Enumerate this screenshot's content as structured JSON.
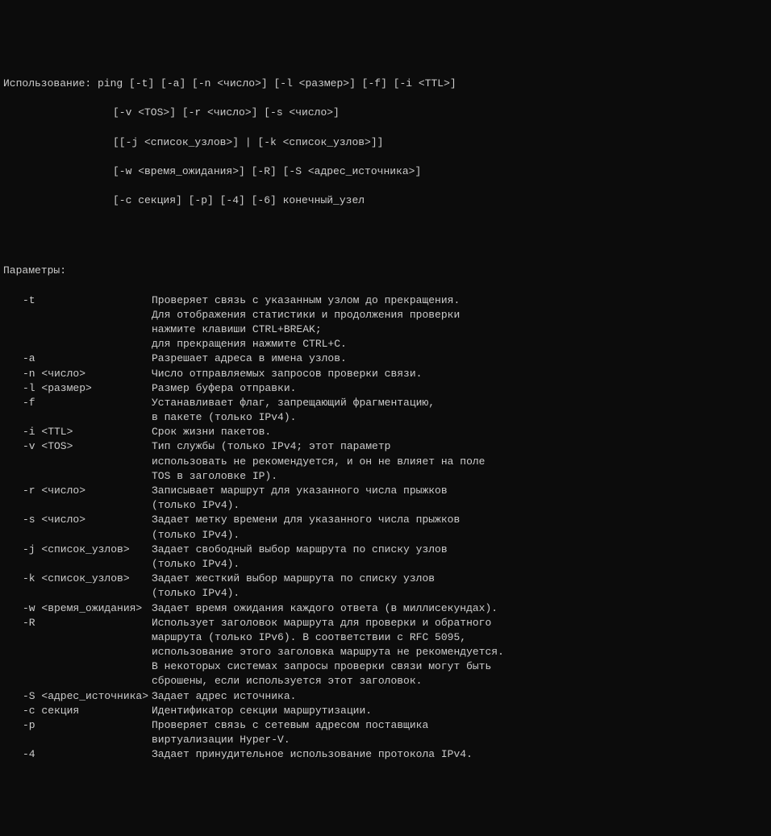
{
  "usage": {
    "label": "Использование:",
    "lines": [
      "ping [-t] [-a] [-n <число>] [-l <размер>] [-f] [-i <TTL>]",
      "[-v <TOS>] [-r <число>] [-s <число>]",
      "[[-j <список_узлов>] | [-k <список_узлов>]]",
      "[-w <время_ожидания>] [-R] [-S <адрес_источника>]",
      "[-c секция] [-p] [-4] [-6] конечный_узел"
    ]
  },
  "params_header": "Параметры:",
  "params": [
    {
      "opt": "-t",
      "desc": [
        "Проверяет связь с указанным узлом до прекращения.",
        "Для отображения статистики и продолжения проверки",
        "нажмите клавиши CTRL+BREAK;",
        "для прекращения нажмите CTRL+C."
      ]
    },
    {
      "opt": "-a",
      "desc": [
        "Разрешает адреса в имена узлов."
      ]
    },
    {
      "opt": "-n <число>",
      "desc": [
        "Число отправляемых запросов проверки связи."
      ]
    },
    {
      "opt": "-l <размер>",
      "desc": [
        "Размер буфера отправки."
      ]
    },
    {
      "opt": "-f",
      "desc": [
        "Устанавливает флаг, запрещающий фрагментацию,",
        "в пакете (только IPv4)."
      ]
    },
    {
      "opt": "-i <TTL>",
      "desc": [
        "Срок жизни пакетов."
      ]
    },
    {
      "opt": "-v <TOS>",
      "desc": [
        "Тип службы (только IPv4; этот параметр",
        "использовать не рекомендуется, и он не влияет на поле",
        "TOS в заголовке IP)."
      ]
    },
    {
      "opt": "-r <число>",
      "desc": [
        "Записывает маршрут для указанного числа прыжков",
        "(только IPv4)."
      ]
    },
    {
      "opt": "-s <число>",
      "desc": [
        "Задает метку времени для указанного числа прыжков",
        "(только IPv4)."
      ]
    },
    {
      "opt": "-j <список_узлов>",
      "desc": [
        "Задает свободный выбор маршрута по списку узлов",
        "(только IPv4)."
      ]
    },
    {
      "opt": "-k <список_узлов>",
      "desc": [
        "Задает жесткий выбор маршрута по списку узлов",
        "(только IPv4)."
      ]
    },
    {
      "opt": "-w <время_ожидания>",
      "desc": [
        "Задает время ожидания каждого ответа (в миллисекундах)."
      ]
    },
    {
      "opt": "-R",
      "desc": [
        "Использует заголовок маршрута для проверки и обратного",
        "маршрута (только IPv6). В соответствии с RFC 5095,",
        "использование этого заголовка маршрута не рекомендуется.",
        "В некоторых системах запросы проверки связи могут быть",
        "сброшены, если используется этот заголовок."
      ]
    },
    {
      "opt": "-S <адрес_источника>",
      "desc": [
        "Задает адрес источника."
      ]
    },
    {
      "opt": "-c секция",
      "desc": [
        "Идентификатор секции маршрутизации."
      ]
    },
    {
      "opt": "-p",
      "desc": [
        "Проверяет связь с сетевым адресом поставщика",
        "виртуализации Hyper-V."
      ]
    },
    {
      "opt": "-4",
      "desc": [
        "Задает принудительное использование протокола IPv4."
      ]
    }
  ]
}
